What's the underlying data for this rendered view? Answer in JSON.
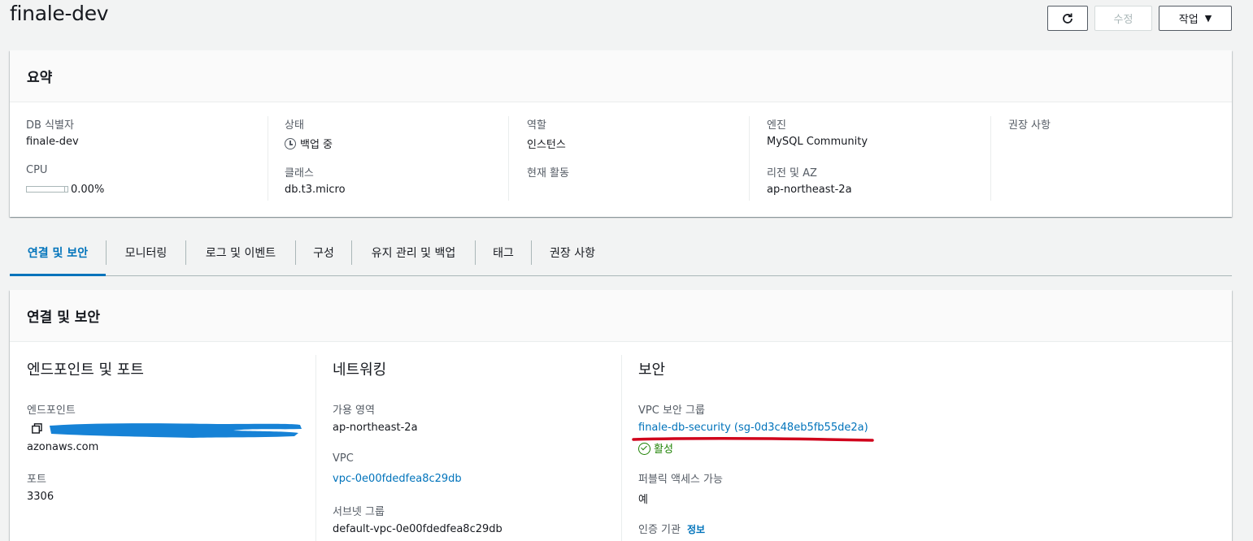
{
  "header": {
    "title": "finale-dev",
    "edit_label": "수정",
    "actions_label": "작업",
    "refresh_icon": "refresh-icon",
    "actions_caret": "▼"
  },
  "summary": {
    "title": "요약",
    "db_identifier_label": "DB 식별자",
    "db_identifier": "finale-dev",
    "cpu_label": "CPU",
    "cpu_percent": 0.0,
    "cpu_value": "0.00%",
    "status_label": "상태",
    "status_value": "백업 중",
    "class_label": "클래스",
    "class_value": "db.t3.micro",
    "role_label": "역할",
    "role_value": "인스턴스",
    "current_activity_label": "현재 활동",
    "engine_label": "엔진",
    "engine_value": "MySQL Community",
    "region_label": "리전 및 AZ",
    "region_value": "ap-northeast-2a",
    "recommendations_label": "권장 사항"
  },
  "tabs": [
    {
      "label": "연결 및 보안",
      "active": true
    },
    {
      "label": "모니터링"
    },
    {
      "label": "로그 및 이벤트"
    },
    {
      "label": "구성"
    },
    {
      "label": "유지 관리 및 백업"
    },
    {
      "label": "태그"
    },
    {
      "label": "권장 사항"
    }
  ],
  "connectivity": {
    "title": "연결 및 보안",
    "endpoint_section": {
      "title": "엔드포인트 및 포트",
      "endpoint_label": "엔드포인트",
      "endpoint_suffix": "azonaws.com",
      "port_label": "포트",
      "port_value": "3306"
    },
    "networking_section": {
      "title": "네트워킹",
      "az_label": "가용 영역",
      "az_value": "ap-northeast-2a",
      "vpc_label": "VPC",
      "vpc_value": "vpc-0e00fdedfea8c29db",
      "subnet_label": "서브넷 그룹",
      "subnet_value": "default-vpc-0e00fdedfea8c29db"
    },
    "security_section": {
      "title": "보안",
      "vpc_sg_label": "VPC 보안 그룹",
      "vpc_sg_value": "finale-db-security (sg-0d3c48eb5fb55de2a)",
      "sg_status": "활성",
      "public_access_label": "퍼블릭 액세스 가능",
      "public_access_value": "예",
      "ca_label": "인증 기관",
      "info_link": "정보"
    }
  },
  "colors": {
    "link": "#0073bb",
    "ok": "#1d8102",
    "annotation_red": "#d0021b",
    "redaction_blue": "#0a7bd4"
  }
}
